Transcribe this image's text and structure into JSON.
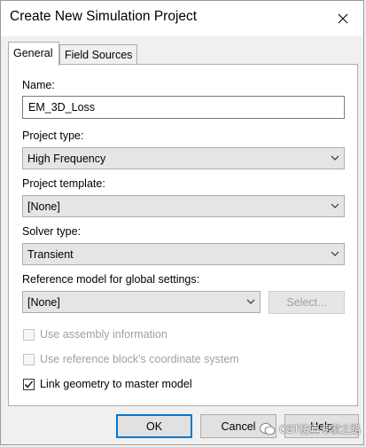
{
  "window": {
    "title": "Create New Simulation Project"
  },
  "tabs": [
    {
      "label": "General",
      "active": true
    },
    {
      "label": "Field Sources",
      "active": false
    }
  ],
  "form": {
    "name": {
      "label": "Name:",
      "value": "EM_3D_Loss"
    },
    "project_type": {
      "label": "Project type:",
      "value": "High Frequency"
    },
    "project_template": {
      "label": "Project template:",
      "value": "[None]"
    },
    "solver_type": {
      "label": "Solver type:",
      "value": "Transient"
    },
    "reference_model": {
      "label": "Reference model for global settings:",
      "value": "[None]",
      "select_label": "Select..."
    }
  },
  "checkboxes": [
    {
      "label": "Use assembly information",
      "checked": false,
      "enabled": false
    },
    {
      "label": "Use reference block's coordinate system",
      "checked": false,
      "enabled": false
    },
    {
      "label": "Link geometry to master model",
      "checked": true,
      "enabled": true
    }
  ],
  "buttons": {
    "ok": "OK",
    "cancel": "Cancel",
    "help": "Help"
  },
  "watermark": {
    "text": "CST仿真专家之路"
  },
  "colors": {
    "focus_border": "#0078d7",
    "disabled_text": "#a0a0a0"
  }
}
